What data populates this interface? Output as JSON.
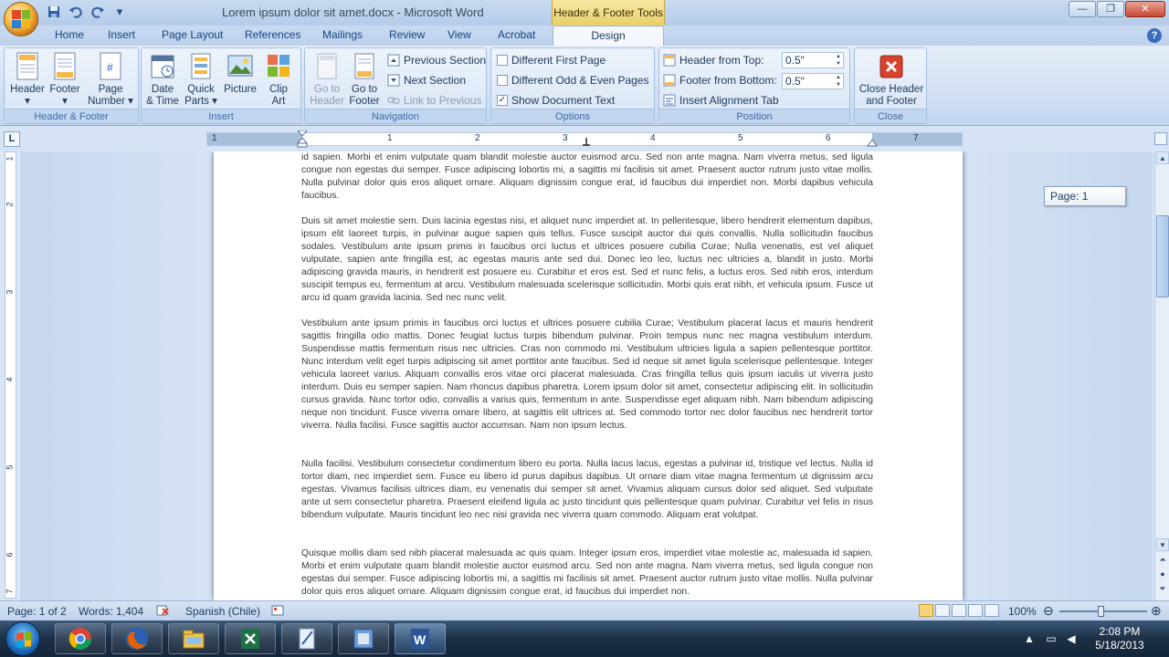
{
  "window": {
    "title": "Lorem ipsum dolor sit amet.docx - Microsoft Word",
    "contextual_tab_group": "Header & Footer Tools",
    "controls": [
      "minimize",
      "maximize",
      "close"
    ]
  },
  "qat": [
    "save-icon",
    "undo-icon",
    "redo-icon",
    "customize-icon"
  ],
  "ribbon_tabs": [
    {
      "label": "Home"
    },
    {
      "label": "Insert"
    },
    {
      "label": "Page Layout"
    },
    {
      "label": "References"
    },
    {
      "label": "Mailings"
    },
    {
      "label": "Review"
    },
    {
      "label": "View"
    },
    {
      "label": "Acrobat"
    },
    {
      "label": "Design",
      "active": true
    }
  ],
  "ribbon": {
    "header_footer": {
      "label": "Header & Footer",
      "header": "Header",
      "footer": "Footer",
      "page_number_line1": "Page",
      "page_number_line2": "Number"
    },
    "insert": {
      "label": "Insert",
      "date_time_line1": "Date",
      "date_time_line2": "& Time",
      "quick_parts_line1": "Quick",
      "quick_parts_line2": "Parts",
      "picture": "Picture",
      "clip_art_line1": "Clip",
      "clip_art_line2": "Art"
    },
    "navigation": {
      "label": "Navigation",
      "go_to_header_line1": "Go to",
      "go_to_header_line2": "Header",
      "go_to_footer_line1": "Go to",
      "go_to_footer_line2": "Footer",
      "previous_section": "Previous Section",
      "next_section": "Next Section",
      "link_to_previous": "Link to Previous"
    },
    "options": {
      "label": "Options",
      "different_first_page": "Different First Page",
      "different_odd_even": "Different Odd & Even Pages",
      "show_document_text": "Show Document Text",
      "different_first_page_checked": false,
      "different_odd_even_checked": false,
      "show_document_text_checked": true
    },
    "position": {
      "label": "Position",
      "header_from_top_label": "Header from Top:",
      "header_from_top_value": "0.5\"",
      "footer_from_bottom_label": "Footer from Bottom:",
      "footer_from_bottom_value": "0.5\"",
      "insert_alignment_tab": "Insert Alignment Tab"
    },
    "close": {
      "label": "Close",
      "close_line1": "Close Header",
      "close_line2": "and Footer"
    }
  },
  "ruler": {
    "tab_selector": "L",
    "numbers": [
      "1",
      "1",
      "2",
      "3",
      "4",
      "5",
      "6",
      "7"
    ]
  },
  "vruler_numbers": [
    "1",
    "2",
    "3",
    "4",
    "5",
    "6",
    "7"
  ],
  "page_tooltip": "Page: 1",
  "document": {
    "paragraphs": [
      "id sapien. Morbi et enim vulputate quam blandit molestie auctor euismod arcu. Sed non ante magna. Nam viverra metus, sed ligula congue non egestas dui semper. Fusce adipiscing lobortis mi, a sagittis mi facilisis sit amet. Praesent auctor rutrum justo vitae mollis. Nulla pulvinar dolor quis eros aliquet ornare. Aliquam dignissim congue erat, id faucibus dui imperdiet non. Morbi dapibus vehicula faucibus.",
      "Duis sit amet molestie sem. Duis lacinia egestas nisi, et aliquet nunc imperdiet at. In pellentesque, libero hendrerit elementum dapibus, ipsum elit laoreet turpis, in pulvinar augue sapien quis tellus. Fusce suscipit auctor dui quis convallis. Nulla sollicitudin faucibus sodales. Vestibulum ante ipsum primis in faucibus orci luctus et ultrices posuere cubilia Curae; Nulla venenatis, est vel aliquet vulputate, sapien ante fringilla est, ac egestas mauris ante sed dui. Donec leo leo, luctus nec ultricies a, blandit in justo. Morbi adipiscing gravida mauris, in hendrerit est posuere eu. Curabitur et eros est. Sed et nunc felis, a luctus eros. Sed nibh eros, interdum suscipit tempus eu, fermentum at arcu. Vestibulum malesuada scelerisque sollicitudin. Morbi quis erat nibh, et vehicula ipsum. Fusce ut arcu id quam gravida lacinia. Sed nec nunc velit.",
      "Vestibulum ante ipsum primis in faucibus orci luctus et ultrices posuere cubilia Curae; Vestibulum placerat lacus et mauris hendrerit sagittis fringilla odio mattis. Donec feugiat luctus turpis bibendum pulvinar. Proin tempus nunc nec magna vestibulum interdum. Suspendisse mattis fermentum risus nec ultricies. Cras non commodo mi. Vestibulum ultricies ligula a sapien pellentesque porttitor. Nunc interdum velit eget turpis adipiscing sit amet porttitor ante faucibus. Sed id neque sit amet ligula scelerisque pellentesque. Integer vehicula laoreet varius. Aliquam convallis eros vitae orci placerat malesuada. Cras fringilla tellus quis ipsum iaculis ut viverra justo interdum. Duis eu semper sapien. Nam rhoncus dapibus pharetra. Lorem ipsum dolor sit amet, consectetur adipiscing elit. In sollicitudin cursus gravida. Nunc tortor odio, convallis a varius quis, fermentum in ante. Suspendisse eget aliquam nibh. Nam bibendum adipiscing neque non tincidunt. Fusce viverra ornare libero, at sagittis elit ultrices at. Sed commodo tortor nec dolor faucibus nec hendrerit tortor viverra. Nulla facilisi. Fusce sagittis auctor accumsan. Nam non ipsum lectus.",
      "Nulla facilisi. Vestibulum consectetur condimentum libero eu porta. Nulla lacus lacus, egestas a pulvinar id, tristique vel lectus. Nulla id tortor diam, nec imperdiet sem. Fusce eu libero id purus dapibus dapibus. Ut ornare diam vitae magna fermentum ut dignissim arcu egestas. Vivamus facilisis ultrices diam, eu venenatis dui semper sit amet. Vivamus aliquam cursus dolor sed aliquet. Sed vulputate ante ut sem consectetur pharetra. Praesent eleifend ligula ac justo tincidunt quis pellentesque quam pulvinar. Curabitur vel felis in risus bibendum vulputate. Mauris tincidunt leo nec nisi gravida nec viverra quam commodo. Aliquam erat volutpat.",
      "Quisque mollis diam sed nibh placerat malesuada ac quis quam. Integer ipsum eros, imperdiet vitae molestie ac, malesuada id sapien. Morbi et enim vulputate quam blandit molestie auctor euismod arcu. Sed non ante magna. Nam viverra metus, sed ligula congue non egestas dui semper. Fusce adipiscing lobortis mi, a sagittis mi facilisis sit amet. Praesent auctor rutrum justo vitae mollis. Nulla pulvinar dolor quis eros aliquet ornare. Aliquam dignissim congue erat, id faucibus dui imperdiet non."
    ]
  },
  "status": {
    "page": "Page: 1 of 2",
    "words": "Words: 1,404",
    "language": "Spanish (Chile)",
    "zoom": "100%"
  },
  "taskbar": {
    "apps": [
      "chrome-icon",
      "firefox-icon",
      "explorer-icon",
      "excel-icon",
      "notepad-icon",
      "media-icon",
      "word-icon"
    ],
    "time": "2:08 PM",
    "date": "5/18/2013"
  },
  "colors": {
    "ribbon_bg": "#dfe9f5",
    "accent": "#15428b",
    "tools_tab": "#f3dc85",
    "spelling": "#e04040"
  }
}
